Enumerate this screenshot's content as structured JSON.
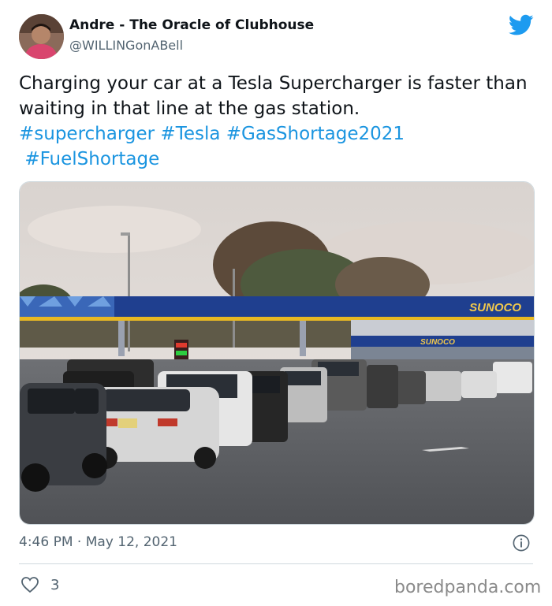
{
  "author": {
    "name": "Andre - The Oracle of Clubhouse",
    "handle": "@WILLINGonABell"
  },
  "tweet": {
    "text": "Charging your car at a Tesla Supercharger is faster than waiting in that line at the gas station.",
    "hashtags": [
      "#supercharger",
      "#Tesla",
      "#GasShortage2021",
      "#FuelShortage"
    ],
    "timestamp": "4:46 PM · May 12, 2021",
    "likes": "3"
  },
  "photo": {
    "canopy_sign": "SUNOCO",
    "store_sign": "SUNOCO"
  },
  "watermark": "boredpanda.com",
  "icons": [
    "twitter-bird-icon",
    "info-icon",
    "heart-icon"
  ],
  "colors": {
    "link": "#1b95e0",
    "twitter_blue": "#1d9bf0",
    "muted": "#536471"
  }
}
